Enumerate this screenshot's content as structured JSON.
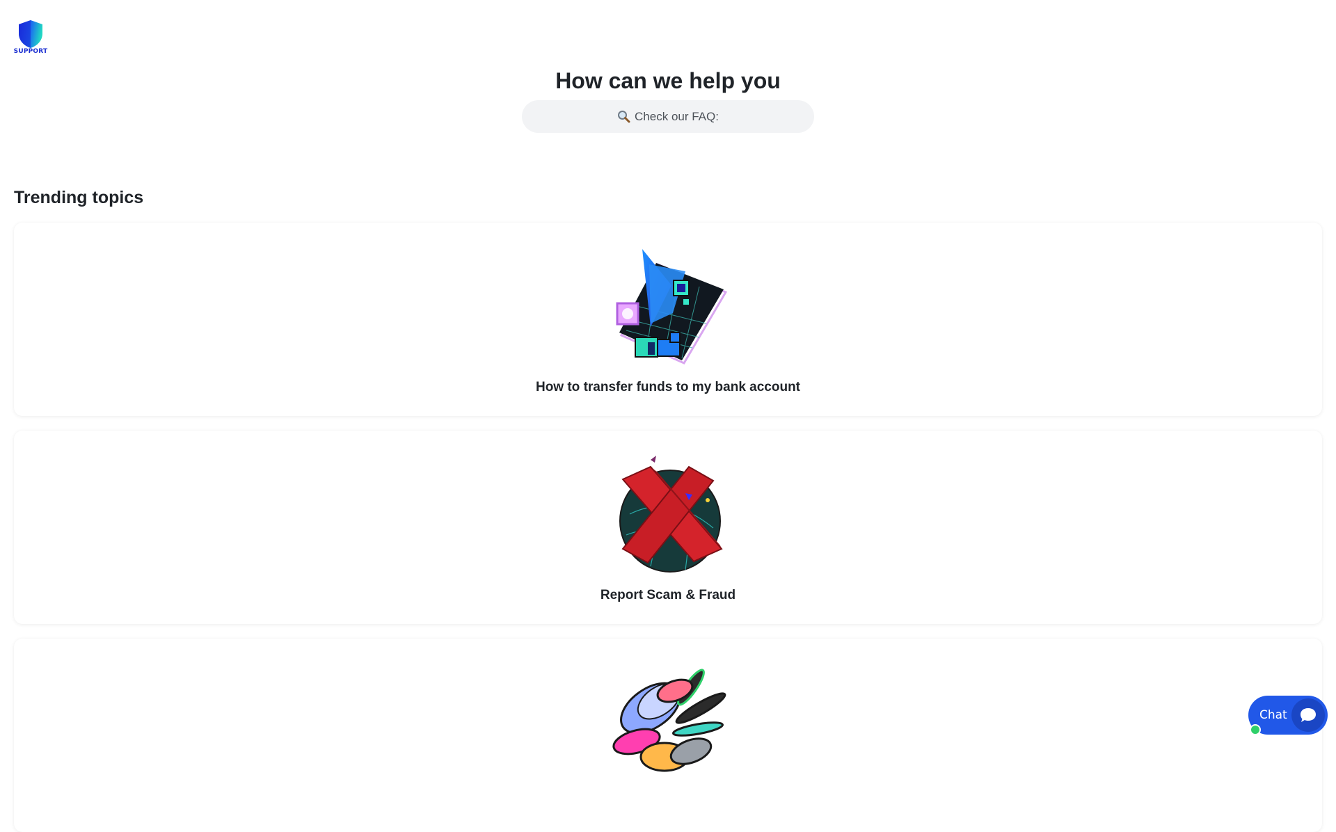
{
  "brand": {
    "logo_text": "SUPPORT",
    "colors": {
      "shield_start": "#1a3cf0",
      "shield_end": "#1fd0c8"
    }
  },
  "hero": {
    "title": "How can we help you"
  },
  "search": {
    "placeholder": "Check our FAQ:",
    "icon": "magnifier-icon"
  },
  "trending": {
    "title": "Trending topics",
    "topics": [
      {
        "label": "How to transfer funds to my bank account",
        "icon": "wallet-transfer-illustration"
      },
      {
        "label": "Report Scam & Fraud",
        "icon": "red-x-fraud-illustration"
      },
      {
        "label": "",
        "icon": "coins-illustration"
      }
    ]
  },
  "chat": {
    "label": "Chat",
    "icon": "chat-bubble-icon",
    "status": "online",
    "colors": {
      "button": "#2158e8",
      "status": "#2fd06a"
    }
  }
}
